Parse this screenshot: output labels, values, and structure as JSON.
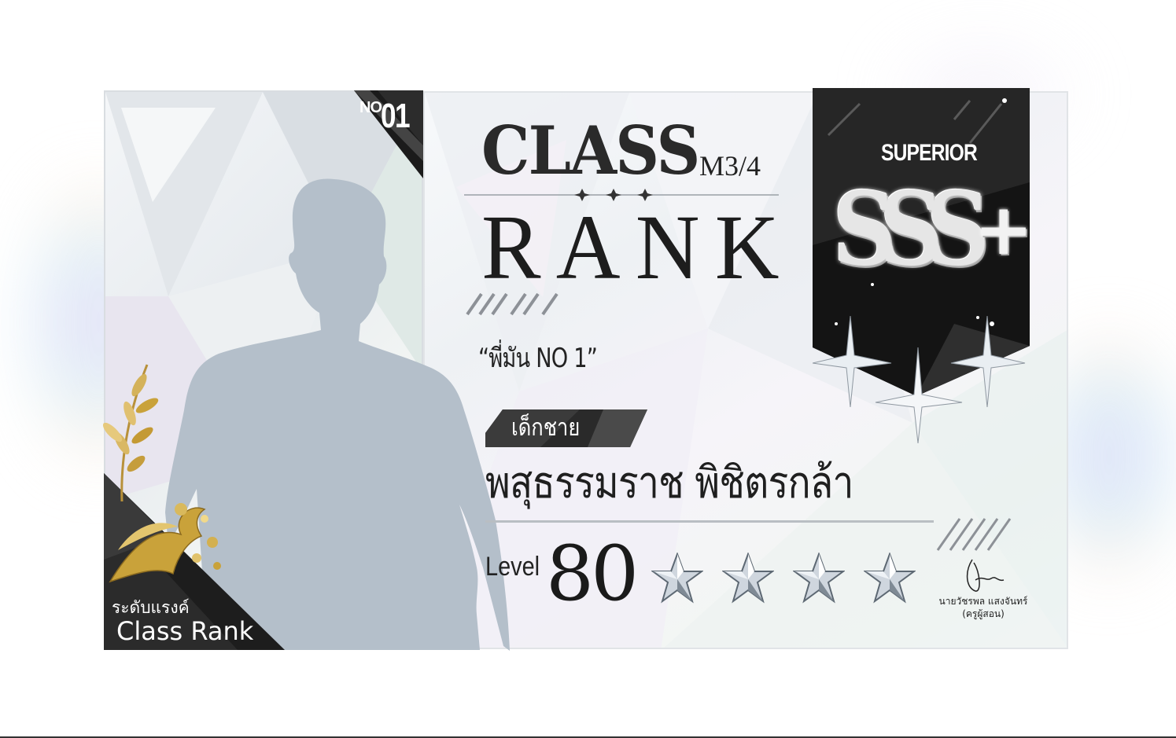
{
  "card": {
    "number_prefix": "NO.",
    "number": "01",
    "title_line1": "CLASS",
    "room": "M3/4",
    "title_line2": "RANK",
    "nickname": "“พี่มัน NO 1”",
    "gender": "เด็กชาย",
    "student_name": "พสุธรรมราช พิชิตรกล้า",
    "level_label": "Level",
    "level_value": "80",
    "star_count": 4,
    "corner_label_thai": "ระดับแรงค์",
    "corner_label_en": "Class Rank"
  },
  "badge": {
    "tier": "SUPERIOR",
    "grade": "SSS",
    "plus": "+"
  },
  "teacher": {
    "name": "นายวัชรพล แสงจันทร์",
    "role": "(ครูผู้สอน)"
  },
  "icons": [
    "star-icon",
    "phoenix-emblem-icon",
    "gold-leaf-icon",
    "sparkle-icon",
    "signature-mark"
  ],
  "colors": {
    "dark_panel": "#1b1b1b",
    "silhouette": "#b4bfca",
    "gold": "#c9a23a",
    "silver": "#d8dde2"
  }
}
